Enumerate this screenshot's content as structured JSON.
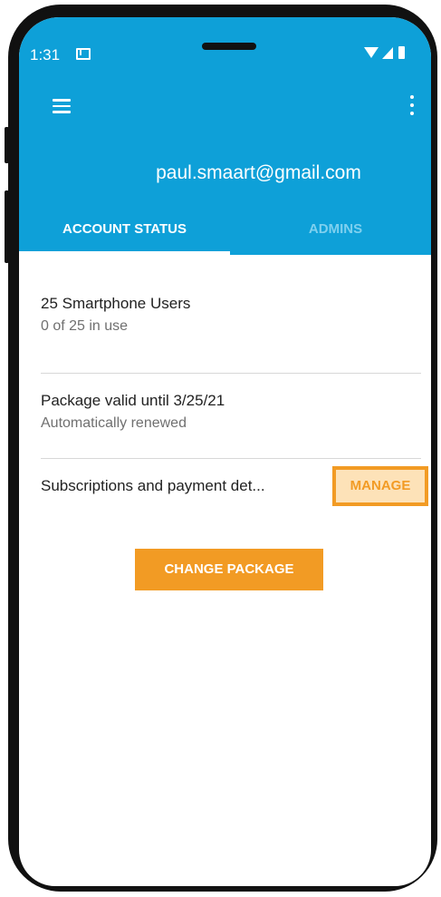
{
  "status_bar": {
    "time": "1:31",
    "icons": [
      "mail-icon",
      "wifi-icon",
      "signal-icon",
      "battery-icon"
    ]
  },
  "app_bar": {
    "account_email": "paul.smaart@gmail.com",
    "icons": [
      "menu-icon",
      "more-vertical-icon"
    ]
  },
  "tabs": [
    {
      "label": "ACCOUNT STATUS",
      "active": true
    },
    {
      "label": "ADMINS",
      "active": false
    }
  ],
  "account": {
    "users_title": "25 Smartphone Users",
    "users_usage": "0 of 25 in use",
    "package_title": "Package valid until 3/25/21",
    "package_renewal": "Automatically renewed",
    "subscriptions_label": "Subscriptions and payment det...",
    "manage_label": "MANAGE",
    "change_package_label": "CHANGE PACKAGE"
  },
  "colors": {
    "primary": "#0ea0d8",
    "accent": "#f29b24",
    "highlight_fill": "#fde2b8"
  }
}
